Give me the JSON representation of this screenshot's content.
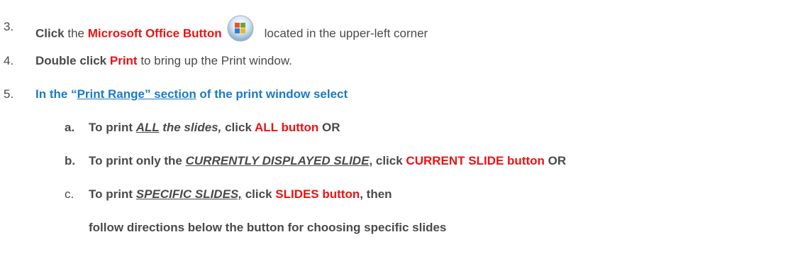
{
  "steps": [
    {
      "num": "3.",
      "word1": "Click",
      "word2": " the ",
      "word3": "Microsoft Office Button",
      "word4": "located in the upper-left corner",
      "icon": "office-button-icon"
    },
    {
      "num": "4.",
      "word1": "Double click",
      "word2": " ",
      "word3": "Print",
      "word4": " to bring up the Print window."
    },
    {
      "num": "5.",
      "word1": "In the “",
      "word2": "Print Range” section",
      "word3": " of the print window select"
    }
  ],
  "substeps": [
    {
      "letter": "a.",
      "p1": "To print ",
      "p2": "ALL",
      "p3": " the slides,",
      "p4": " click ",
      "p5": "ALL button",
      "p6": " OR"
    },
    {
      "letter": "b.",
      "p1": "To print only the ",
      "p2": "CURRENTLY DISPLAYED SLIDE",
      "p3": ", click ",
      "p4": "CURRENT SLIDE button",
      "p5": " OR"
    },
    {
      "letter": "c.",
      "p1": "To print ",
      "p2": "SPECIFIC SLIDES,",
      "p3": " click ",
      "p4": "SLIDES button",
      "p5": ", then",
      "p6": "follow directions below the button for choosing specific slides"
    }
  ],
  "colors": {
    "text": "#4a4a4a",
    "red": "#ee1111",
    "blue": "#1a7ac8"
  }
}
